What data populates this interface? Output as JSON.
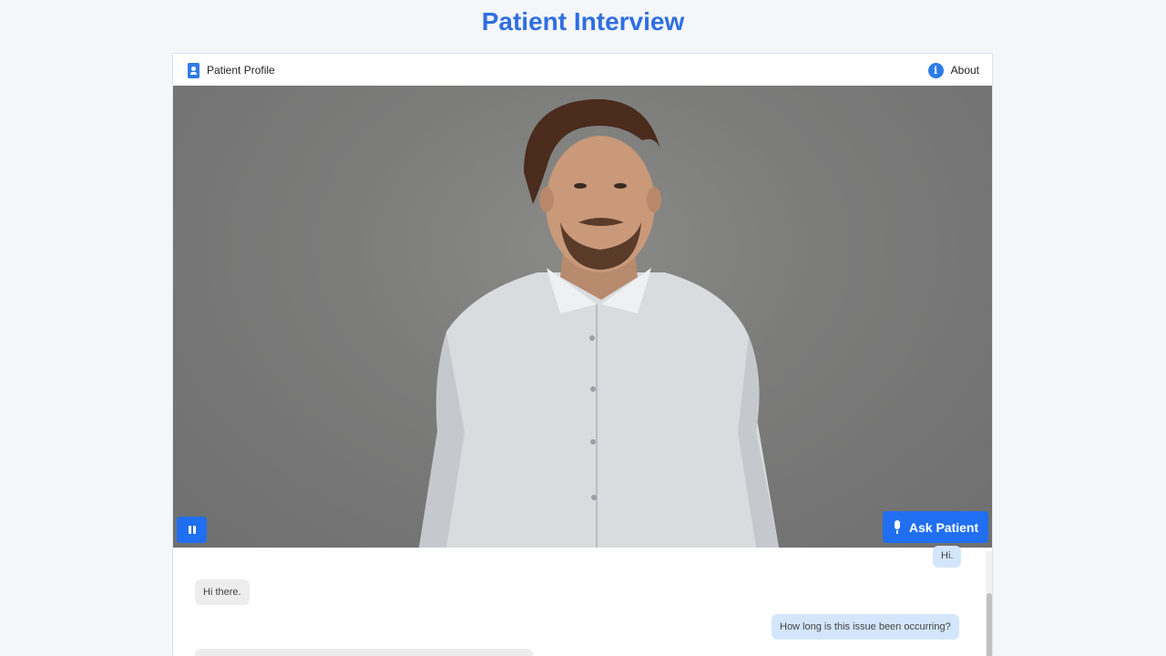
{
  "page": {
    "title": "Patient Interview"
  },
  "topbar": {
    "profile_label": "Patient Profile",
    "about_label": "About"
  },
  "video": {
    "pause_icon": "pause-icon",
    "ask_label": "Ask Patient",
    "ask_icon": "microphone-icon"
  },
  "chat": {
    "messages": [
      {
        "from": "user",
        "text": "Hi."
      },
      {
        "from": "patient",
        "text": "Hi there."
      },
      {
        "from": "user",
        "text": "How long is this issue been occurring?"
      },
      {
        "from": "patient",
        "text": ""
      }
    ]
  },
  "colors": {
    "accent": "#2f6fe0",
    "button": "#1f6ff0",
    "user_bubble": "#d4e6fb",
    "patient_bubble": "#ededed"
  }
}
